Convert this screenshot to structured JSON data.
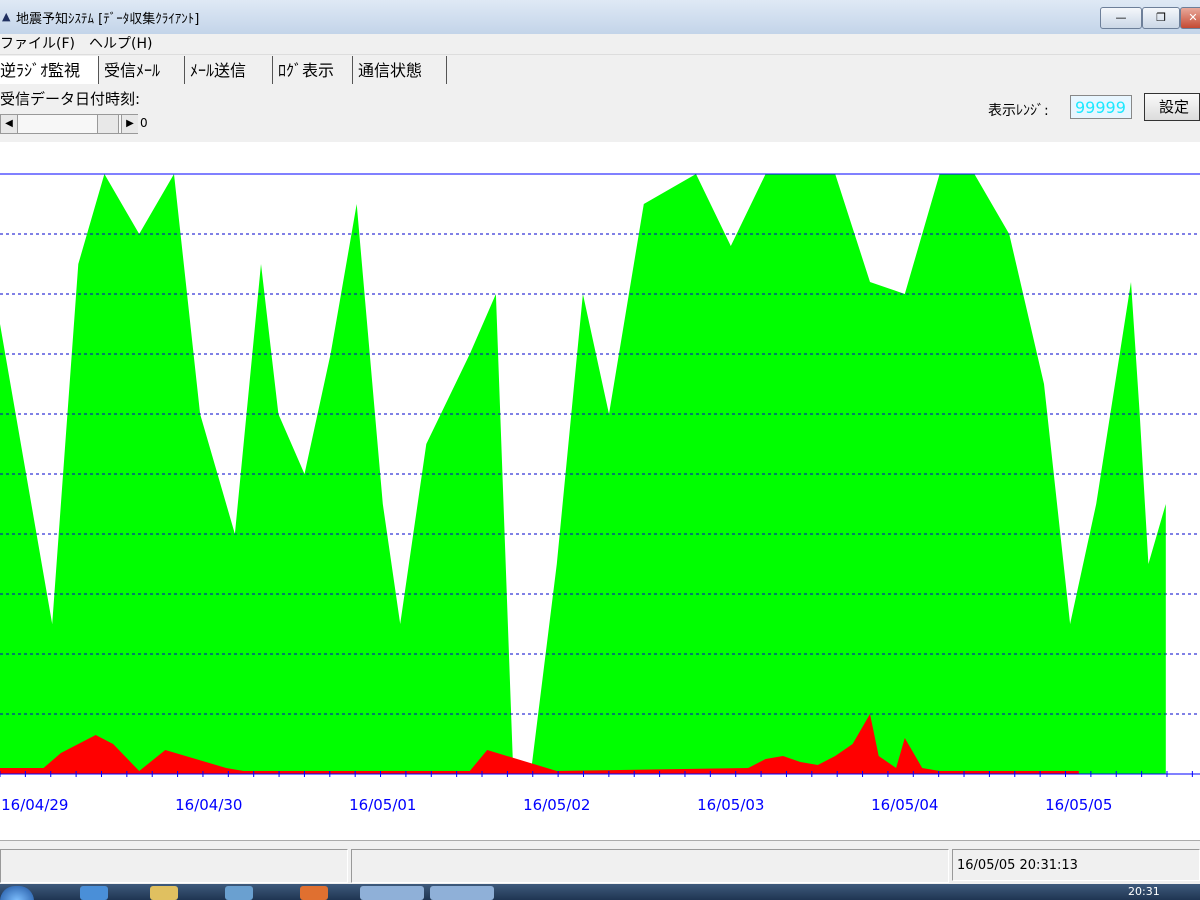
{
  "window": {
    "title": "地震予知ｼｽﾃﾑ [ﾃﾞｰﾀ収集ｸﾗｲｱﾝﾄ]",
    "icon": "app-icon"
  },
  "menu": {
    "file": "ファイル(F)",
    "help": "ヘルプ(H)"
  },
  "tabs": [
    "逆ﾗｼﾞｵ監視",
    "受信ﾒｰﾙ",
    "ﾒｰﾙ送信",
    "ﾛｸﾞ表示",
    "通信状態"
  ],
  "controls": {
    "recv_label": "受信データ日付時刻:",
    "scroll_value": "0",
    "range_label": "表示ﾚﾝｼﾞ:",
    "range_value": "99999",
    "set_button": "設定"
  },
  "status": {
    "timestamp": "16/05/05 20:31:13"
  },
  "taskbar": {
    "clock": "20:31"
  },
  "colors": {
    "signal": "#00ff00",
    "peak": "#ff0000",
    "grid": "#0000cc",
    "axis": "#0000ff",
    "range_text": "#1ee8ff"
  },
  "chart_data": {
    "type": "area",
    "x_tick_labels": [
      "16/04/29",
      "16/04/30",
      "16/05/01",
      "16/05/02",
      "16/05/03",
      "16/05/04",
      "16/05/05"
    ],
    "ylim": [
      0,
      99999
    ],
    "grid": true,
    "series": [
      {
        "color": "#00ff00",
        "x": [
          0,
          0.3,
          0.45,
          0.6,
          0.8,
          1.0,
          1.15,
          1.35,
          1.5,
          1.6,
          1.75,
          1.9,
          2.05,
          2.2,
          2.3,
          2.45,
          2.7,
          2.85,
          2.95,
          3.05,
          3.2,
          3.35,
          3.5,
          3.7,
          4.0,
          4.2,
          4.4,
          4.6,
          4.8,
          5.0,
          5.2,
          5.4,
          5.6,
          5.8,
          6.0,
          6.15,
          6.3,
          6.5,
          6.55,
          6.6,
          6.7
        ],
        "values": [
          75000,
          25000,
          85000,
          100000,
          90000,
          100000,
          60000,
          40000,
          85000,
          60000,
          50000,
          70000,
          95000,
          45000,
          25000,
          55000,
          70000,
          80000,
          0,
          0,
          35000,
          80000,
          60000,
          95000,
          100000,
          88000,
          100000,
          100000,
          100000,
          82000,
          80000,
          100000,
          100000,
          90000,
          65000,
          25000,
          45000,
          82000,
          60000,
          35000,
          45000
        ]
      },
      {
        "color": "#ff0000",
        "x": [
          0,
          0.25,
          0.35,
          0.45,
          0.55,
          0.65,
          0.8,
          0.95,
          1.3,
          1.4,
          2.5,
          2.7,
          2.8,
          3.2,
          4.3,
          4.4,
          4.5,
          4.6,
          4.7,
          4.8,
          4.9,
          5.0,
          5.05,
          5.15,
          5.2,
          5.3,
          5.4,
          5.5,
          6.2
        ],
        "values": [
          1000,
          1000,
          3500,
          5000,
          6500,
          5000,
          500,
          4000,
          1000,
          500,
          500,
          500,
          4000,
          500,
          1000,
          2500,
          3000,
          2000,
          1500,
          3000,
          5000,
          10000,
          3000,
          1000,
          6000,
          1000,
          500,
          500,
          500
        ]
      }
    ]
  }
}
